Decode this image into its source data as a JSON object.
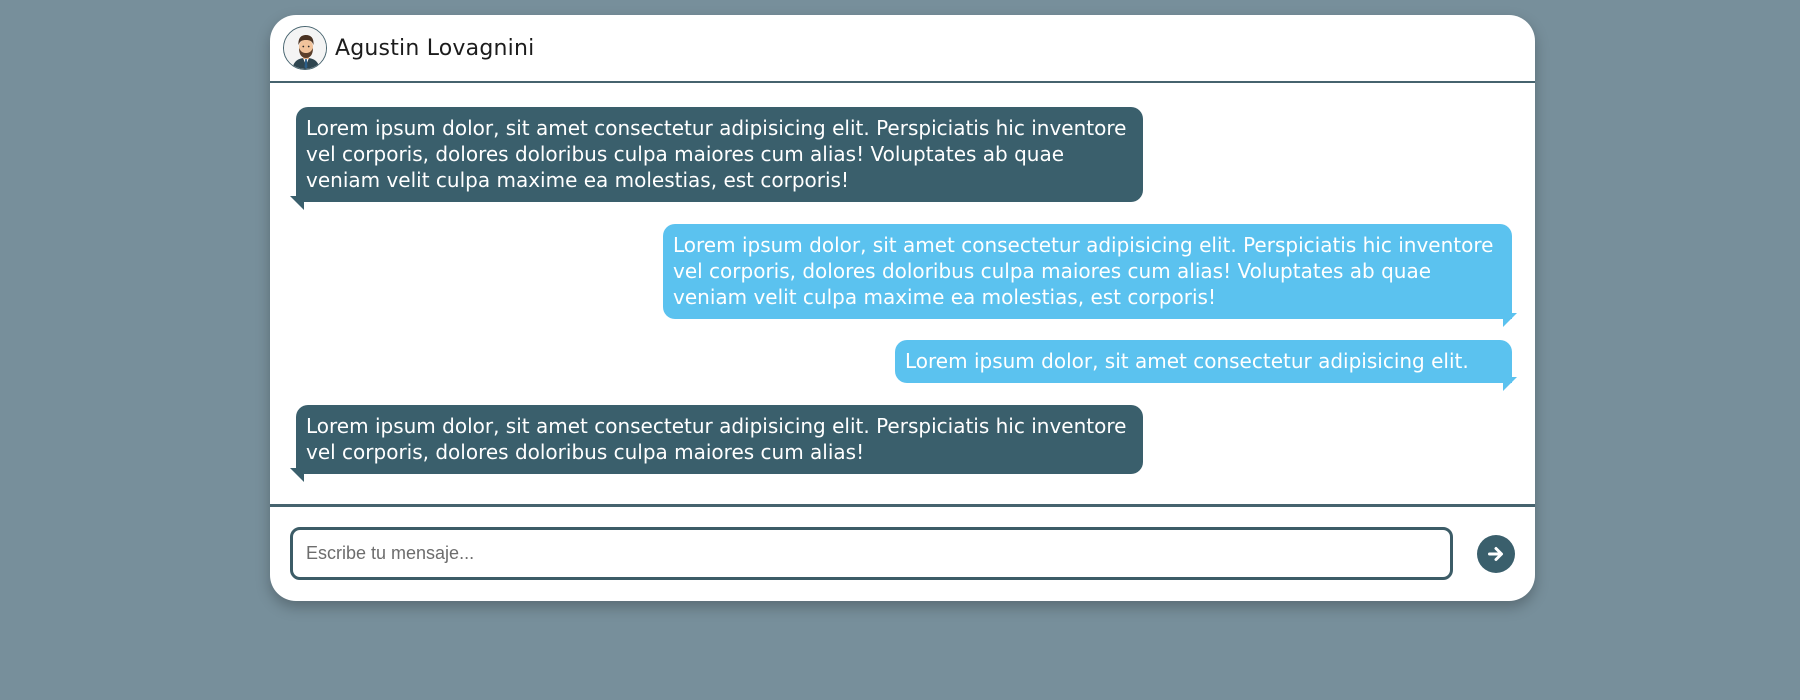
{
  "contact": {
    "name": "Agustin Lovagnini",
    "avatar_icon": "user-avatar-icon"
  },
  "messages": [
    {
      "direction": "received",
      "text": "Lorem ipsum dolor, sit amet consectetur adipisicing elit. Perspiciatis hic inventore vel corporis, dolores doloribus culpa maiores cum alias! Voluptates ab quae veniam velit culpa maxime ea molestias, est corporis!"
    },
    {
      "direction": "sent",
      "text": "Lorem ipsum dolor, sit amet consectetur adipisicing elit. Perspiciatis hic inventore vel corporis, dolores doloribus culpa maiores cum alias! Voluptates ab quae veniam velit culpa maxime ea molestias, est corporis!"
    },
    {
      "direction": "sent",
      "text": "Lorem ipsum dolor, sit amet consectetur adipisicing elit."
    },
    {
      "direction": "received",
      "text": "Lorem ipsum dolor, sit amet consectetur adipisicing elit. Perspiciatis hic inventore vel corporis, dolores doloribus culpa maiores cum alias!"
    }
  ],
  "composer": {
    "placeholder": "Escribe tu mensaje...",
    "value": "",
    "send_icon": "arrow-right-icon"
  },
  "colors": {
    "page_background": "#778f9b",
    "received_bubble": "#3a5f6c",
    "sent_bubble": "#5bc2ef",
    "accent": "#3a5f6c"
  }
}
